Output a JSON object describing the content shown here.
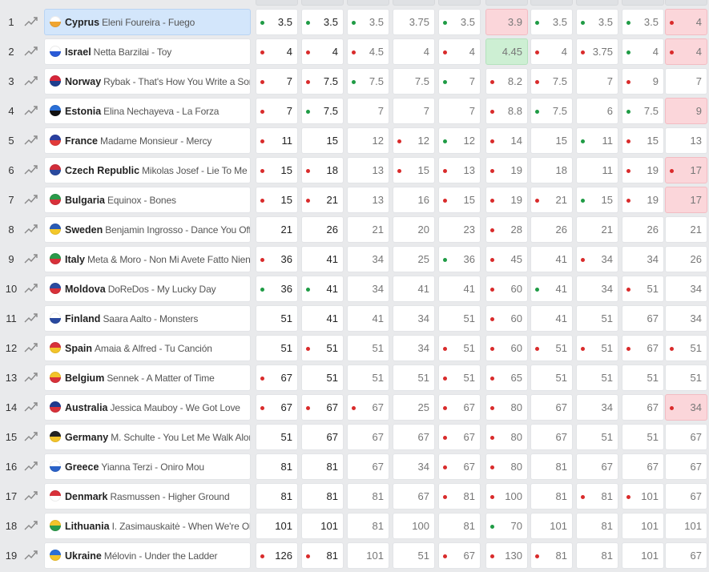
{
  "columns": 10,
  "rows": [
    {
      "rank": "1",
      "country": "Cyprus",
      "song": "Eleni Foureira - Fuego",
      "flag": [
        "#ffffff",
        "#f0a530"
      ],
      "selected": true,
      "cells": [
        [
          "3.5",
          "g",
          ""
        ],
        [
          "3.5",
          "g",
          ""
        ],
        [
          "3.5",
          "g",
          ""
        ],
        [
          "3.75",
          "",
          ""
        ],
        [
          "3.5",
          "g",
          ""
        ],
        [
          "3.9",
          "",
          "red"
        ],
        [
          "3.5",
          "g",
          ""
        ],
        [
          "3.5",
          "g",
          ""
        ],
        [
          "3.5",
          "g",
          ""
        ],
        [
          "4",
          "r",
          "red"
        ]
      ]
    },
    {
      "rank": "2",
      "country": "Israel",
      "song": "Netta Barzilai - Toy",
      "flag": [
        "#ffffff",
        "#2a5bd7"
      ],
      "cells": [
        [
          "4",
          "r",
          ""
        ],
        [
          "4",
          "r",
          ""
        ],
        [
          "4.5",
          "r",
          ""
        ],
        [
          "4",
          "",
          ""
        ],
        [
          "4",
          "r",
          ""
        ],
        [
          "4.45",
          "",
          "green"
        ],
        [
          "4",
          "r",
          ""
        ],
        [
          "3.75",
          "r",
          ""
        ],
        [
          "4",
          "g",
          ""
        ],
        [
          "4",
          "r",
          "red"
        ]
      ]
    },
    {
      "rank": "3",
      "country": "Norway",
      "song": "Rybak - That's How You Write a Song",
      "flag": [
        "#d6263a",
        "#1e3f8f"
      ],
      "cells": [
        [
          "7",
          "r",
          ""
        ],
        [
          "7.5",
          "r",
          ""
        ],
        [
          "7.5",
          "g",
          ""
        ],
        [
          "7.5",
          "",
          ""
        ],
        [
          "7",
          "g",
          ""
        ],
        [
          "8.2",
          "r",
          ""
        ],
        [
          "7.5",
          "r",
          ""
        ],
        [
          "7",
          "",
          ""
        ],
        [
          "9",
          "r",
          ""
        ],
        [
          "7",
          "",
          ""
        ]
      ]
    },
    {
      "rank": "4",
      "country": "Estonia",
      "song": "Elina Nechayeva - La Forza",
      "flag": [
        "#2a6fd6",
        "#111111"
      ],
      "cells": [
        [
          "7",
          "r",
          ""
        ],
        [
          "7.5",
          "g",
          ""
        ],
        [
          "7",
          "",
          ""
        ],
        [
          "7",
          "",
          ""
        ],
        [
          "7",
          "",
          ""
        ],
        [
          "8.8",
          "r",
          ""
        ],
        [
          "7.5",
          "g",
          ""
        ],
        [
          "6",
          "",
          ""
        ],
        [
          "7.5",
          "g",
          ""
        ],
        [
          "9",
          "",
          "red"
        ]
      ]
    },
    {
      "rank": "5",
      "country": "France",
      "song": "Madame Monsieur - Mercy",
      "flag": [
        "#2a3f9f",
        "#e23a3a"
      ],
      "cells": [
        [
          "11",
          "r",
          ""
        ],
        [
          "15",
          "",
          ""
        ],
        [
          "12",
          "",
          ""
        ],
        [
          "12",
          "r",
          ""
        ],
        [
          "12",
          "g",
          ""
        ],
        [
          "14",
          "r",
          ""
        ],
        [
          "15",
          "",
          ""
        ],
        [
          "11",
          "g",
          ""
        ],
        [
          "15",
          "r",
          ""
        ],
        [
          "13",
          "",
          ""
        ]
      ]
    },
    {
      "rank": "6",
      "country": "Czech Republic",
      "song": "Mikolas Josef - Lie To Me",
      "flag": [
        "#d22d3a",
        "#2a4a9f"
      ],
      "cells": [
        [
          "15",
          "r",
          ""
        ],
        [
          "18",
          "r",
          ""
        ],
        [
          "13",
          "",
          ""
        ],
        [
          "15",
          "r",
          ""
        ],
        [
          "13",
          "r",
          ""
        ],
        [
          "19",
          "r",
          ""
        ],
        [
          "18",
          "",
          ""
        ],
        [
          "11",
          "",
          ""
        ],
        [
          "19",
          "r",
          ""
        ],
        [
          "17",
          "r",
          "red"
        ]
      ]
    },
    {
      "rank": "7",
      "country": "Bulgaria",
      "song": "Equinox - Bones",
      "flag": [
        "#2b9a4a",
        "#d8313a"
      ],
      "cells": [
        [
          "15",
          "r",
          ""
        ],
        [
          "21",
          "r",
          ""
        ],
        [
          "13",
          "",
          ""
        ],
        [
          "16",
          "",
          ""
        ],
        [
          "15",
          "r",
          ""
        ],
        [
          "19",
          "r",
          ""
        ],
        [
          "21",
          "r",
          ""
        ],
        [
          "15",
          "g",
          ""
        ],
        [
          "19",
          "r",
          ""
        ],
        [
          "17",
          "",
          "red"
        ]
      ]
    },
    {
      "rank": "8",
      "country": "Sweden",
      "song": "Benjamin Ingrosso - Dance You Off",
      "flag": [
        "#2a5bb5",
        "#f4c82a"
      ],
      "cells": [
        [
          "21",
          "",
          ""
        ],
        [
          "26",
          "",
          ""
        ],
        [
          "21",
          "",
          ""
        ],
        [
          "20",
          "",
          ""
        ],
        [
          "23",
          "",
          ""
        ],
        [
          "28",
          "r",
          ""
        ],
        [
          "26",
          "",
          ""
        ],
        [
          "21",
          "",
          ""
        ],
        [
          "26",
          "",
          ""
        ],
        [
          "21",
          "",
          ""
        ]
      ]
    },
    {
      "rank": "9",
      "country": "Italy",
      "song": "Meta & Moro - Non Mi Avete Fatto Niente",
      "flag": [
        "#2a9a4a",
        "#d8313a"
      ],
      "cells": [
        [
          "36",
          "r",
          ""
        ],
        [
          "41",
          "",
          ""
        ],
        [
          "34",
          "",
          ""
        ],
        [
          "25",
          "",
          ""
        ],
        [
          "36",
          "g",
          ""
        ],
        [
          "45",
          "r",
          ""
        ],
        [
          "41",
          "",
          ""
        ],
        [
          "34",
          "r",
          ""
        ],
        [
          "34",
          "",
          ""
        ],
        [
          "26",
          "",
          ""
        ]
      ]
    },
    {
      "rank": "10",
      "country": "Moldova",
      "song": "DoReDos - My Lucky Day",
      "flag": [
        "#2a4a9f",
        "#d8313a"
      ],
      "cells": [
        [
          "36",
          "g",
          ""
        ],
        [
          "41",
          "g",
          ""
        ],
        [
          "34",
          "",
          ""
        ],
        [
          "41",
          "",
          ""
        ],
        [
          "41",
          "",
          ""
        ],
        [
          "60",
          "r",
          ""
        ],
        [
          "41",
          "g",
          ""
        ],
        [
          "34",
          "",
          ""
        ],
        [
          "51",
          "r",
          ""
        ],
        [
          "34",
          "",
          ""
        ]
      ]
    },
    {
      "rank": "11",
      "country": "Finland",
      "song": "Saara Aalto - Monsters",
      "flag": [
        "#ffffff",
        "#2a4aa0"
      ],
      "cells": [
        [
          "51",
          "",
          ""
        ],
        [
          "41",
          "",
          ""
        ],
        [
          "41",
          "",
          ""
        ],
        [
          "34",
          "",
          ""
        ],
        [
          "51",
          "",
          ""
        ],
        [
          "60",
          "r",
          ""
        ],
        [
          "41",
          "",
          ""
        ],
        [
          "51",
          "",
          ""
        ],
        [
          "67",
          "",
          ""
        ],
        [
          "34",
          "",
          ""
        ]
      ]
    },
    {
      "rank": "12",
      "country": "Spain",
      "song": "Amaia & Alfred - Tu Canción",
      "flag": [
        "#d8313a",
        "#f3c42a"
      ],
      "cells": [
        [
          "51",
          "",
          ""
        ],
        [
          "51",
          "r",
          ""
        ],
        [
          "51",
          "",
          ""
        ],
        [
          "34",
          "",
          ""
        ],
        [
          "51",
          "r",
          ""
        ],
        [
          "60",
          "r",
          ""
        ],
        [
          "51",
          "r",
          ""
        ],
        [
          "51",
          "r",
          ""
        ],
        [
          "67",
          "r",
          ""
        ],
        [
          "51",
          "r",
          ""
        ]
      ]
    },
    {
      "rank": "13",
      "country": "Belgium",
      "song": "Sennek - A Matter of Time",
      "flag": [
        "#f3c42a",
        "#d8313a"
      ],
      "cells": [
        [
          "67",
          "r",
          ""
        ],
        [
          "51",
          "",
          ""
        ],
        [
          "51",
          "",
          ""
        ],
        [
          "51",
          "",
          ""
        ],
        [
          "51",
          "r",
          ""
        ],
        [
          "65",
          "r",
          ""
        ],
        [
          "51",
          "",
          ""
        ],
        [
          "51",
          "",
          ""
        ],
        [
          "51",
          "",
          ""
        ],
        [
          "51",
          "",
          ""
        ]
      ]
    },
    {
      "rank": "14",
      "country": "Australia",
      "song": "Jessica Mauboy - We Got Love",
      "flag": [
        "#1f3a8f",
        "#d8313a"
      ],
      "cells": [
        [
          "67",
          "r",
          ""
        ],
        [
          "67",
          "r",
          ""
        ],
        [
          "67",
          "r",
          ""
        ],
        [
          "25",
          "",
          ""
        ],
        [
          "67",
          "r",
          ""
        ],
        [
          "80",
          "r",
          ""
        ],
        [
          "67",
          "",
          ""
        ],
        [
          "34",
          "",
          ""
        ],
        [
          "67",
          "",
          ""
        ],
        [
          "34",
          "r",
          "red"
        ]
      ]
    },
    {
      "rank": "15",
      "country": "Germany",
      "song": "M. Schulte - You Let Me Walk Alone",
      "flag": [
        "#222222",
        "#f3c42a"
      ],
      "cells": [
        [
          "51",
          "",
          ""
        ],
        [
          "67",
          "",
          ""
        ],
        [
          "67",
          "",
          ""
        ],
        [
          "67",
          "",
          ""
        ],
        [
          "67",
          "r",
          ""
        ],
        [
          "80",
          "r",
          ""
        ],
        [
          "67",
          "",
          ""
        ],
        [
          "51",
          "",
          ""
        ],
        [
          "51",
          "",
          ""
        ],
        [
          "67",
          "",
          ""
        ]
      ]
    },
    {
      "rank": "16",
      "country": "Greece",
      "song": "Yianna Terzi - Oniro Mou",
      "flag": [
        "#ffffff",
        "#2a62c8"
      ],
      "cells": [
        [
          "81",
          "",
          ""
        ],
        [
          "81",
          "",
          ""
        ],
        [
          "67",
          "",
          ""
        ],
        [
          "34",
          "",
          ""
        ],
        [
          "67",
          "r",
          ""
        ],
        [
          "80",
          "r",
          ""
        ],
        [
          "81",
          "",
          ""
        ],
        [
          "67",
          "",
          ""
        ],
        [
          "67",
          "",
          ""
        ],
        [
          "67",
          "",
          ""
        ]
      ]
    },
    {
      "rank": "17",
      "country": "Denmark",
      "song": "Rasmussen - Higher Ground",
      "flag": [
        "#d8313a",
        "#ffffff"
      ],
      "cells": [
        [
          "81",
          "",
          ""
        ],
        [
          "81",
          "",
          ""
        ],
        [
          "81",
          "",
          ""
        ],
        [
          "67",
          "",
          ""
        ],
        [
          "81",
          "r",
          ""
        ],
        [
          "100",
          "r",
          ""
        ],
        [
          "81",
          "",
          ""
        ],
        [
          "81",
          "r",
          ""
        ],
        [
          "101",
          "r",
          ""
        ],
        [
          "67",
          "",
          ""
        ]
      ]
    },
    {
      "rank": "18",
      "country": "Lithuania",
      "song": "I. Zasimauskaitė - When We're Old",
      "flag": [
        "#f3c42a",
        "#2a9a4a"
      ],
      "cells": [
        [
          "101",
          "",
          ""
        ],
        [
          "101",
          "",
          ""
        ],
        [
          "81",
          "",
          ""
        ],
        [
          "100",
          "",
          ""
        ],
        [
          "81",
          "",
          ""
        ],
        [
          "70",
          "g",
          ""
        ],
        [
          "101",
          "",
          ""
        ],
        [
          "81",
          "",
          ""
        ],
        [
          "101",
          "",
          ""
        ],
        [
          "101",
          "",
          ""
        ]
      ]
    },
    {
      "rank": "19",
      "country": "Ukraine",
      "song": "Mélovin - Under the Ladder",
      "flag": [
        "#2a6fd6",
        "#f3c42a"
      ],
      "cells": [
        [
          "126",
          "r",
          ""
        ],
        [
          "81",
          "r",
          ""
        ],
        [
          "101",
          "",
          ""
        ],
        [
          "51",
          "",
          ""
        ],
        [
          "67",
          "r",
          ""
        ],
        [
          "130",
          "r",
          ""
        ],
        [
          "81",
          "r",
          ""
        ],
        [
          "81",
          "",
          ""
        ],
        [
          "101",
          "",
          ""
        ],
        [
          "67",
          "",
          ""
        ]
      ]
    }
  ]
}
